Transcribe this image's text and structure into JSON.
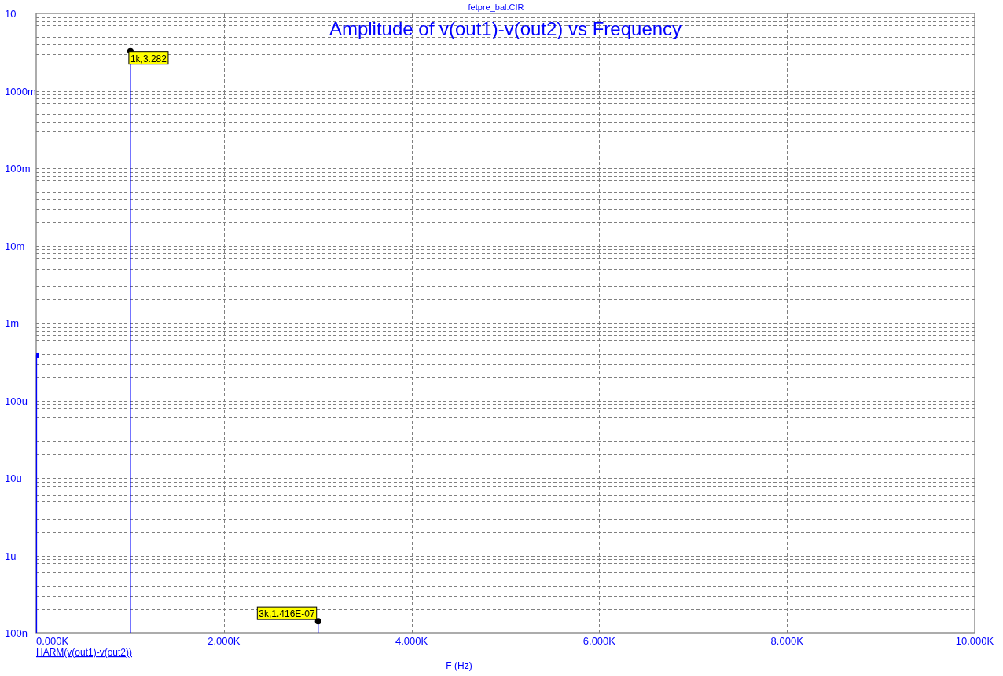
{
  "file_name": "fetpre_bal.CIR",
  "plot": {
    "title": "Amplitude of v(out1)-v(out2) vs Frequency",
    "y_axis_labels": [
      "10",
      "1000m",
      "100m",
      "10m",
      "1m",
      "100u",
      "10u",
      "1u",
      "100n"
    ],
    "x_axis_labels": [
      "0.000K",
      "2.000K",
      "4.000K",
      "6.000K",
      "8.000K",
      "10.000K"
    ],
    "trace_label": "HARM(v(out1)-v(out2))",
    "x_axis_title": "F (Hz)",
    "cursor_labels": [
      "1k,3.282",
      "3k,1.416E-07"
    ]
  }
}
